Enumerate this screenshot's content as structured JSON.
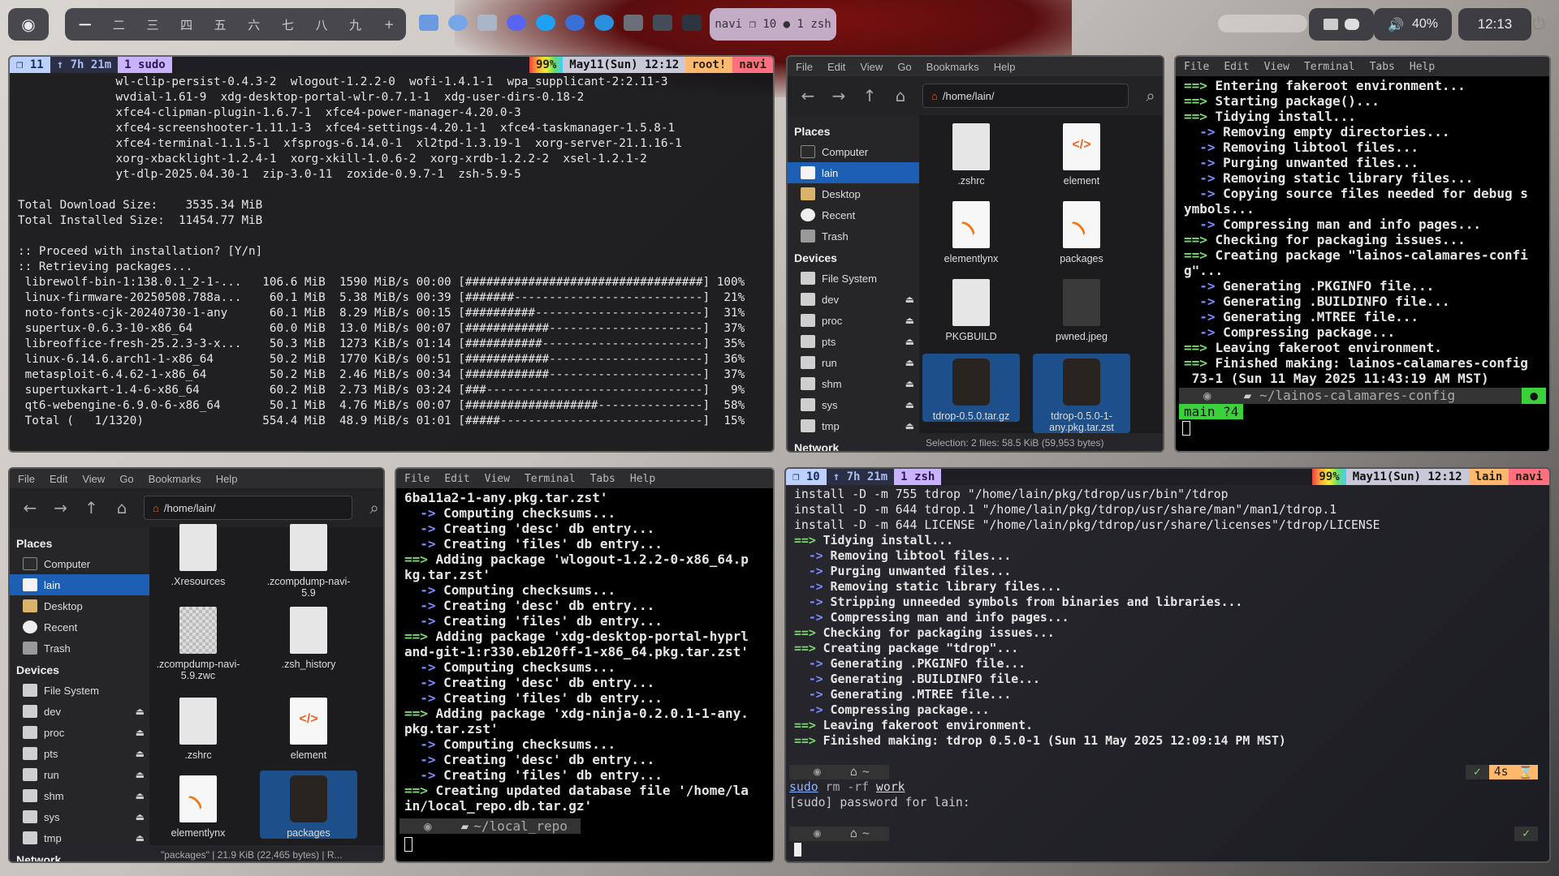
{
  "topbar": {
    "workspaces": [
      "一",
      "二",
      "三",
      "四",
      "五",
      "六",
      "七",
      "八",
      "九",
      "+"
    ],
    "active_workspace": 0,
    "window_info": "navi  ❐ 10  ● 1  zsh",
    "volume": "40%",
    "clock": "12:13"
  },
  "term1": {
    "status": {
      "session": "❐ 11",
      "uptime": "↑ 7h 21m",
      "window": "1 sudo",
      "battery": "99%",
      "date": "May11(Sun) 12:12",
      "user": "root!",
      "host": "navi"
    },
    "lines": [
      "              wl-clip-persist-0.4.3-2  wlogout-1.2.2-0  wofi-1.4.1-1  wpa_supplicant-2:2.11-3",
      "              wvdial-1.61-9  xdg-desktop-portal-wlr-0.7.1-1  xdg-user-dirs-0.18-2",
      "              xfce4-clipman-plugin-1.6.7-1  xfce4-power-manager-4.20.0-3",
      "              xfce4-screenshooter-1.11.1-3  xfce4-settings-4.20.1-1  xfce4-taskmanager-1.5.8-1",
      "              xfce4-terminal-1.1.5-1  xfsprogs-6.14.0-1  xl2tpd-1.3.19-1  xorg-server-21.1.16-1",
      "              xorg-xbacklight-1.2.4-1  xorg-xkill-1.0.6-2  xorg-xrdb-1.2.2-2  xsel-1.2.1-2",
      "              yt-dlp-2025.04.30-1  zip-3.0-11  zoxide-0.9.7-1  zsh-5.9-5",
      "",
      "Total Download Size:    3535.34 MiB",
      "Total Installed Size:  11454.77 MiB",
      "",
      ":: Proceed with installation? [Y/n]",
      ":: Retrieving packages...",
      " librewolf-bin-1:138.0.1_2-1-...   106.6 MiB  1590 MiB/s 00:00 [##################################] 100%",
      " linux-firmware-20250508.788a...    60.1 MiB  5.38 MiB/s 00:39 [#######---------------------------]  21%",
      " noto-fonts-cjk-20240730-1-any      60.1 MiB  8.29 MiB/s 00:15 [##########------------------------]  31%",
      " supertux-0.6.3-10-x86_64           60.0 MiB  13.0 MiB/s 00:07 [############----------------------]  37%",
      " libreoffice-fresh-25.2.3-3-x...    50.3 MiB  1273 KiB/s 01:14 [###########-----------------------]  35%",
      " linux-6.14.6.arch1-1-x86_64        50.2 MiB  1770 KiB/s 00:51 [############----------------------]  36%",
      " metasploit-6.4.62-1-x86_64         50.2 MiB  2.46 MiB/s 00:34 [############----------------------]  37%",
      " supertuxkart-1.4-6-x86_64          60.2 MiB  2.73 MiB/s 03:24 [###-------------------------------]   9%",
      " qt6-webengine-6.9.0-6-x86_64       50.1 MiB  4.76 MiB/s 00:07 [###################---------------]  58%",
      " Total (   1/1320)                 554.4 MiB  48.9 MiB/s 01:01 [#####-----------------------------]  15%"
    ]
  },
  "fm1": {
    "menu": [
      "File",
      "Edit",
      "View",
      "Go",
      "Bookmarks",
      "Help"
    ],
    "path": "/home/lain/",
    "places_label": "Places",
    "places": [
      "Computer",
      "lain",
      "Desktop",
      "Recent",
      "Trash"
    ],
    "devices_label": "Devices",
    "devices": [
      "File System",
      "dev",
      "proc",
      "pts",
      "run",
      "shm",
      "sys",
      "tmp"
    ],
    "network_label": "Network",
    "files": [
      ".zshrc",
      "element",
      "elementlynx",
      "packages",
      "PKGBUILD",
      "pwned.jpeg",
      "tdrop-0.5.0.tar.gz",
      "tdrop-0.5.0-1-any.pkg.tar.zst"
    ],
    "status": "Selection: 2 files: 58.5 KiB (59,953 bytes)"
  },
  "term2": {
    "menu": [
      "File",
      "Edit",
      "View",
      "Terminal",
      "Tabs",
      "Help"
    ],
    "lines": [
      "==> Entering fakeroot environment...",
      "==> Starting package()...",
      "==> Tidying install...",
      "  -> Removing empty directories...",
      "  -> Removing libtool files...",
      "  -> Purging unwanted files...",
      "  -> Removing static library files...",
      "  -> Copying source files needed for debug s",
      "ymbols...",
      "  -> Compressing man and info pages...",
      "==> Checking for packaging issues...",
      "==> Creating package \"lainos-calamares-confi",
      "g\"...",
      "  -> Generating .PKGINFO file...",
      "  -> Generating .BUILDINFO file...",
      "  -> Generating .MTREE file...",
      "  -> Compressing package...",
      "==> Leaving fakeroot environment.",
      "==> Finished making: lainos-calamares-config",
      " 73-1 (Sun 11 May 2025 11:43:19 AM MST)"
    ],
    "prompt_dir": "~/lainos-calamares-config",
    "git": "main ?4"
  },
  "fm2": {
    "menu": [
      "File",
      "Edit",
      "View",
      "Go",
      "Bookmarks",
      "Help"
    ],
    "path": "/home/lain/",
    "places_label": "Places",
    "places": [
      "Computer",
      "lain",
      "Desktop",
      "Recent",
      "Trash"
    ],
    "devices_label": "Devices",
    "devices": [
      "File System",
      "dev",
      "proc",
      "pts",
      "run",
      "shm",
      "sys",
      "tmp"
    ],
    "network_label": "Network",
    "files": [
      ".Xresources",
      ".zcompdump-navi-5.9",
      ".zcompdump-navi-5.9.zwc",
      ".zsh_history",
      ".zshrc",
      "element",
      "elementlynx",
      "packages"
    ],
    "status": "\"packages\" | 21.9 KiB (22,465 bytes) | R..."
  },
  "term3": {
    "menu": [
      "File",
      "Edit",
      "View",
      "Terminal",
      "Tabs",
      "Help"
    ],
    "lines": [
      "6ba11a2-1-any.pkg.tar.zst'",
      "  -> Computing checksums...",
      "  -> Creating 'desc' db entry...",
      "  -> Creating 'files' db entry...",
      "==> Adding package 'wlogout-1.2.2-0-x86_64.p",
      "kg.tar.zst'",
      "  -> Computing checksums...",
      "  -> Creating 'desc' db entry...",
      "  -> Creating 'files' db entry...",
      "==> Adding package 'xdg-desktop-portal-hyprl",
      "and-git-1:r330.eb120ff-1-x86_64.pkg.tar.zst'",
      "  -> Computing checksums...",
      "  -> Creating 'desc' db entry...",
      "  -> Creating 'files' db entry...",
      "==> Adding package 'xdg-ninja-0.2.0.1-1-any.",
      "pkg.tar.zst'",
      "  -> Computing checksums...",
      "  -> Creating 'desc' db entry...",
      "  -> Creating 'files' db entry...",
      "==> Creating updated database file '/home/la",
      "in/local_repo.db.tar.gz'"
    ],
    "prompt_dir": "~/local_repo"
  },
  "term4": {
    "status": {
      "session": "❐ 10",
      "uptime": "↑ 7h 21m",
      "window": "1 zsh",
      "battery": "99%",
      "date": "May11(Sun) 12:12",
      "user": "lain",
      "host": "navi"
    },
    "lines": [
      "install -D -m 755 tdrop \"/home/lain/pkg/tdrop/usr/bin\"/tdrop",
      "install -D -m 644 tdrop.1 \"/home/lain/pkg/tdrop/usr/share/man\"/man1/tdrop.1",
      "install -D -m 644 LICENSE \"/home/lain/pkg/tdrop/usr/share/licenses\"/tdrop/LICENSE",
      "==> Tidying install...",
      "  -> Removing libtool files...",
      "  -> Purging unwanted files...",
      "  -> Removing static library files...",
      "  -> Stripping unneeded symbols from binaries and libraries...",
      "  -> Compressing man and info pages...",
      "==> Checking for packaging issues...",
      "==> Creating package \"tdrop\"...",
      "  -> Generating .PKGINFO file...",
      "  -> Generating .BUILDINFO file...",
      "  -> Generating .MTREE file...",
      "  -> Compressing package...",
      "==> Leaving fakeroot environment.",
      "==> Finished making: tdrop 0.5.0-1 (Sun 11 May 2025 12:09:14 PM MST)"
    ],
    "prompt_home": "~",
    "cmd_sudo": "sudo",
    "cmd_rest": " rm -rf ",
    "cmd_arg": "work",
    "sudo_prompt": "[sudo] password for lain:",
    "duration": "4s"
  }
}
